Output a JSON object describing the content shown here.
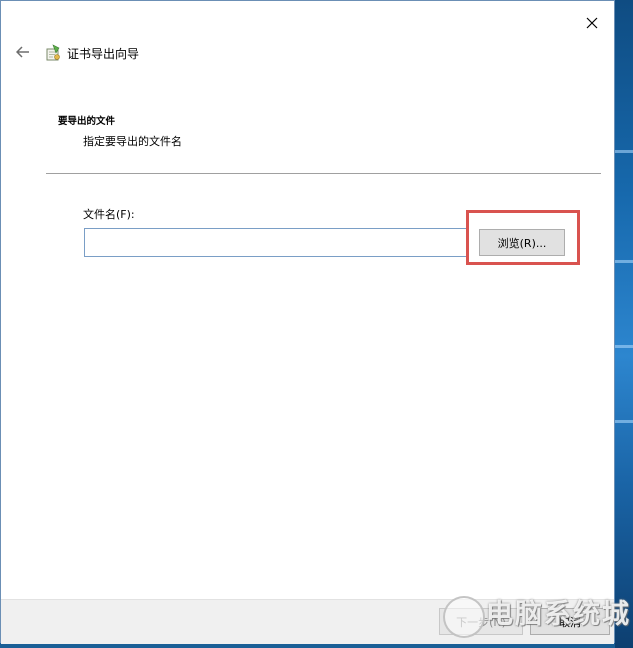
{
  "window": {
    "title": "证书导出向导",
    "close_glyph": "✕",
    "back_glyph": "←"
  },
  "section": {
    "title": "要导出的文件",
    "subtitle": "指定要导出的文件名"
  },
  "form": {
    "file_label": "文件名(F):",
    "file_value": "",
    "browse_label": "浏览(R)..."
  },
  "footer": {
    "next_label": "下一步(N)",
    "cancel_label": "取消"
  },
  "watermark": {
    "text": "电脑系统城"
  },
  "colors": {
    "highlight": "#d9534f",
    "input_border": "#7a9ec6",
    "desktop": "#1a64a6"
  }
}
